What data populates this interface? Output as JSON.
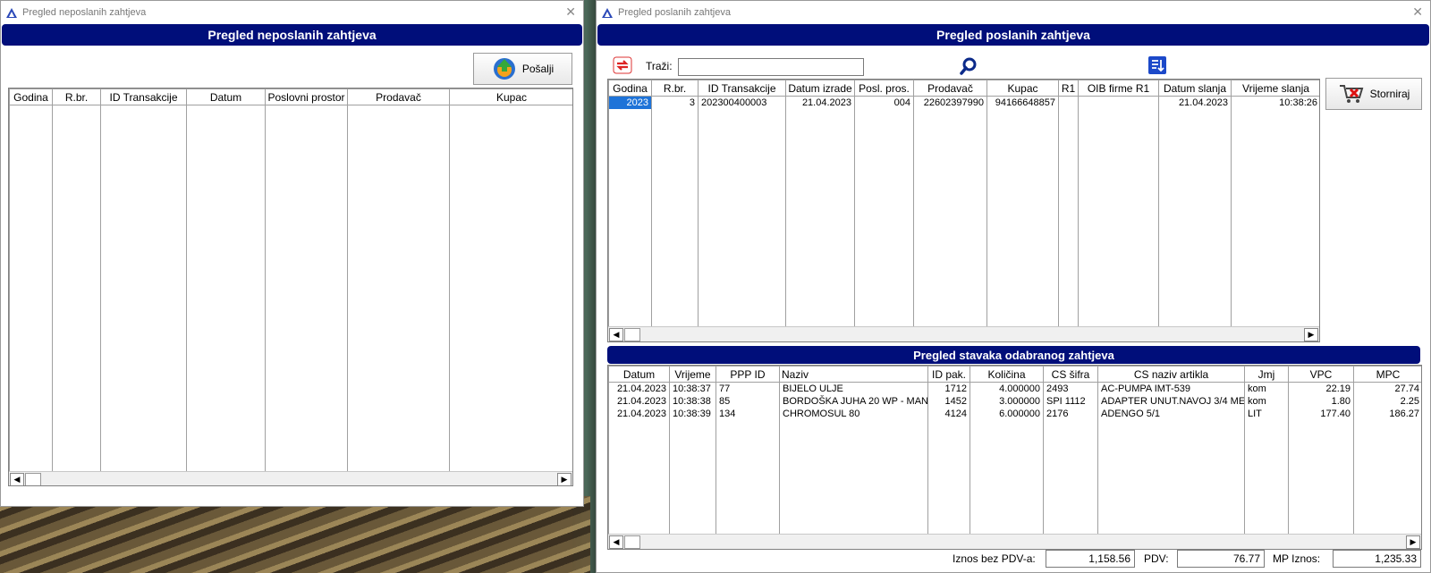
{
  "left_window": {
    "title": "Pregled neposlanih zahtjeva",
    "header": "Pregled neposlanih zahtjeva",
    "send_button": "Pošalji",
    "columns": [
      "Godina",
      "R.br.",
      "ID Transakcije",
      "Datum",
      "Poslovni prostor",
      "Prodavač",
      "Kupac"
    ]
  },
  "right_window": {
    "title": "Pregled poslanih zahtjeva",
    "header": "Pregled poslanih zahtjeva",
    "search_label": "Traži:",
    "search_value": "",
    "storno_button": "Storniraj",
    "columns": [
      "Godina",
      "R.br.",
      "ID Transakcije",
      "Datum izrade",
      "Posl. pros.",
      "Prodavač",
      "Kupac",
      "R1",
      "OIB firme R1",
      "Datum slanja",
      "Vrijeme slanja"
    ],
    "rows": [
      [
        "2023",
        "3",
        "202300400003",
        "21.04.2023",
        "004",
        "22602397990",
        "94166648857",
        "",
        "",
        "21.04.2023",
        "10:38:26"
      ]
    ],
    "items_header": "Pregled stavaka odabranog zahtjeva",
    "item_columns": [
      "Datum",
      "Vrijeme",
      "PPP ID",
      "Naziv",
      "ID pak.",
      "Količina",
      "CS šifra",
      "CS naziv artikla",
      "Jmj",
      "VPC",
      "MPC"
    ],
    "items": [
      [
        "21.04.2023",
        "10:38:37",
        "77",
        "BIJELO ULJE",
        "1712",
        "4.000000",
        "2493",
        "AC-PUMPA IMT-539",
        "kom",
        "22.19",
        "27.74"
      ],
      [
        "21.04.2023",
        "10:38:38",
        "85",
        "BORDOŠKA JUHA 20 WP - MAN",
        "1452",
        "3.000000",
        "SPI 1112",
        "ADAPTER UNUT.NAVOJ 3/4 ME",
        "kom",
        "1.80",
        "2.25"
      ],
      [
        "21.04.2023",
        "10:38:39",
        "134",
        "CHROMOSUL 80",
        "4124",
        "6.000000",
        "2176",
        "ADENGO 5/1",
        "LIT",
        "177.40",
        "186.27"
      ]
    ],
    "totals": {
      "net_label": "Iznos bez PDV-a:",
      "net_value": "1,158.56",
      "vat_label": "PDV:",
      "vat_value": "76.77",
      "gross_label": "MP Iznos:",
      "gross_value": "1,235.33"
    }
  }
}
